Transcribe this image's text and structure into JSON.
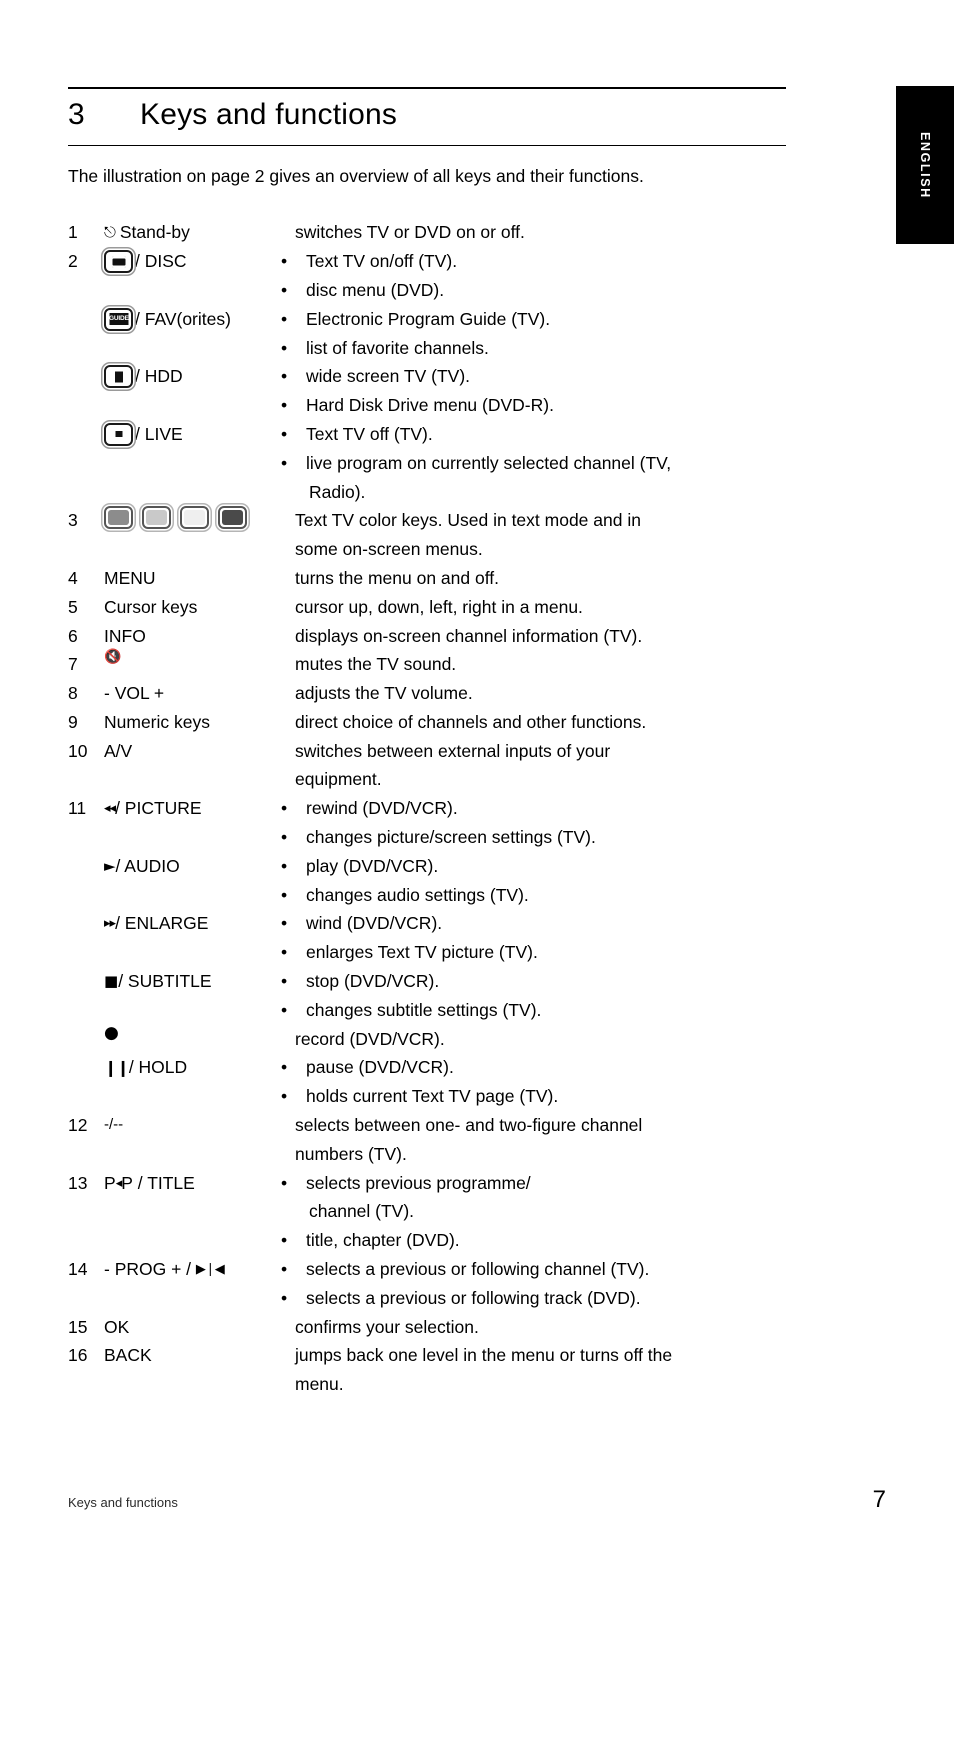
{
  "side_tab": {
    "label": "ENGLISH"
  },
  "chapter": {
    "number": "3",
    "title": "Keys and functions"
  },
  "intro": "The illustration on page 2 gives an overview of all keys and their functions.",
  "keys": [
    {
      "num": "1",
      "label_icon": "power-standby-icon",
      "label_text": "Stand-by",
      "lines": [
        {
          "text": "switches TV or DVD on or off.",
          "bullet": false
        }
      ]
    },
    {
      "num": "2",
      "label_icon": "text-tv-button-icon",
      "label_text": "/ DISC",
      "lines": [
        {
          "text": "Text TV on/off (TV).",
          "bullet": true
        },
        {
          "text": "disc menu (DVD).",
          "bullet": true
        }
      ]
    },
    {
      "num": "",
      "label_icon": "guide-button-icon",
      "label_text": "/ FAV(orites)",
      "lines": [
        {
          "text": "Electronic Program Guide (TV).",
          "bullet": true
        },
        {
          "text": "list of favorite channels.",
          "bullet": true
        }
      ]
    },
    {
      "num": "",
      "label_icon": "wide-screen-button-icon",
      "label_text": "/ HDD",
      "lines": [
        {
          "text": "wide screen TV (TV).",
          "bullet": true
        },
        {
          "text": "Hard Disk Drive menu (DVD-R).",
          "bullet": true
        }
      ]
    },
    {
      "num": "",
      "label_icon": "live-button-icon",
      "label_text": "/ LIVE",
      "lines": [
        {
          "text": "Text TV off (TV).",
          "bullet": true
        },
        {
          "text": "live program on currently selected channel (TV,",
          "bullet": true
        },
        {
          "text": "Radio).",
          "bullet": false,
          "indent": true
        }
      ]
    },
    {
      "num": "3",
      "label_icon": "color-keys-icon",
      "label_text": "",
      "lines": [
        {
          "text": "Text TV color keys. Used in text mode and in",
          "bullet": false
        },
        {
          "text": "some on-screen menus.",
          "bullet": false
        }
      ]
    },
    {
      "num": "4",
      "label_icon": "",
      "label_text": "MENU",
      "lines": [
        {
          "text": "turns the menu on and off.",
          "bullet": false
        }
      ]
    },
    {
      "num": "5",
      "label_icon": "",
      "label_text": "Cursor keys",
      "lines": [
        {
          "text": "cursor up, down, left, right in a menu.",
          "bullet": false
        }
      ]
    },
    {
      "num": "6",
      "label_icon": "",
      "label_text": "INFO",
      "lines": [
        {
          "text": "displays on-screen channel information (TV).",
          "bullet": false
        }
      ]
    },
    {
      "num": "7",
      "label_icon": "mute-icon",
      "label_text": "",
      "lines": [
        {
          "text": "mutes the TV sound.",
          "bullet": false
        }
      ]
    },
    {
      "num": "8",
      "label_icon": "",
      "label_text": "- VOL +",
      "lines": [
        {
          "text": "adjusts the TV volume.",
          "bullet": false
        }
      ]
    },
    {
      "num": "9",
      "label_icon": "",
      "label_text": "Numeric keys",
      "lines": [
        {
          "text": "direct choice of channels and other functions.",
          "bullet": false
        }
      ]
    },
    {
      "num": "10",
      "label_icon": "",
      "label_text": "A/V",
      "lines": [
        {
          "text": "switches between external inputs of your",
          "bullet": false
        },
        {
          "text": "equipment.",
          "bullet": false
        }
      ]
    },
    {
      "num": "11",
      "label_icon": "rewind-icon",
      "label_text": "/ PICTURE",
      "lines": [
        {
          "text": "rewind (DVD/VCR).",
          "bullet": true
        },
        {
          "text": "changes picture/screen settings (TV).",
          "bullet": true
        }
      ]
    },
    {
      "num": "",
      "label_icon": "play-icon",
      "label_text": "/ AUDIO",
      "lines": [
        {
          "text": "play (DVD/VCR).",
          "bullet": true
        },
        {
          "text": "changes audio settings (TV).",
          "bullet": true
        }
      ]
    },
    {
      "num": "",
      "label_icon": "fast-forward-icon",
      "label_text": "/ ENLARGE",
      "lines": [
        {
          "text": "wind (DVD/VCR).",
          "bullet": true
        },
        {
          "text": "enlarges Text TV picture (TV).",
          "bullet": true
        }
      ]
    },
    {
      "num": "",
      "label_icon": "stop-icon",
      "label_text": "/ SUBTITLE",
      "lines": [
        {
          "text": "stop (DVD/VCR).",
          "bullet": true
        },
        {
          "text": "changes subtitle settings (TV).",
          "bullet": true
        }
      ]
    },
    {
      "num": "",
      "label_icon": "record-icon",
      "label_text": "",
      "lines": [
        {
          "text": "record (DVD/VCR).",
          "bullet": false
        }
      ]
    },
    {
      "num": "",
      "label_icon": "pause-icon",
      "label_text": "/ HOLD",
      "lines": [
        {
          "text": "pause (DVD/VCR).",
          "bullet": true
        },
        {
          "text": "holds current Text TV page (TV).",
          "bullet": true
        }
      ]
    },
    {
      "num": "12",
      "label_icon": "",
      "label_text": "-/--",
      "label_small": true,
      "lines": [
        {
          "text": "selects between one- and two-figure channel",
          "bullet": false
        },
        {
          "text": "numbers  (TV).",
          "bullet": false
        }
      ]
    },
    {
      "num": "13",
      "label_icon": "prev-programme-icon",
      "label_text": "/ TITLE",
      "label_prefix": "P",
      "label_mid": "P",
      "lines": [
        {
          "text": "selects previous programme/",
          "bullet": true
        },
        {
          "text": "channel (TV).",
          "bullet": false,
          "indent": true
        },
        {
          "text": "title, chapter (DVD).",
          "bullet": true
        }
      ]
    },
    {
      "num": "14",
      "label_icon": "next-prev-track-icon",
      "label_text": "- PROG + /",
      "label_leading": true,
      "lines": [
        {
          "text": "selects a previous or following channel (TV).",
          "bullet": true
        },
        {
          "text": "selects a previous or following track (DVD).",
          "bullet": true
        }
      ]
    },
    {
      "num": "15",
      "label_icon": "",
      "label_text": "OK",
      "lines": [
        {
          "text": "confirms your selection.",
          "bullet": false
        }
      ]
    },
    {
      "num": "16",
      "label_icon": "",
      "label_text": "BACK",
      "lines": [
        {
          "text": "jumps back one level in the menu or turns off the",
          "bullet": false
        },
        {
          "text": "menu.",
          "bullet": false
        }
      ]
    }
  ],
  "footer": {
    "left": "Keys and functions",
    "page": "7"
  }
}
